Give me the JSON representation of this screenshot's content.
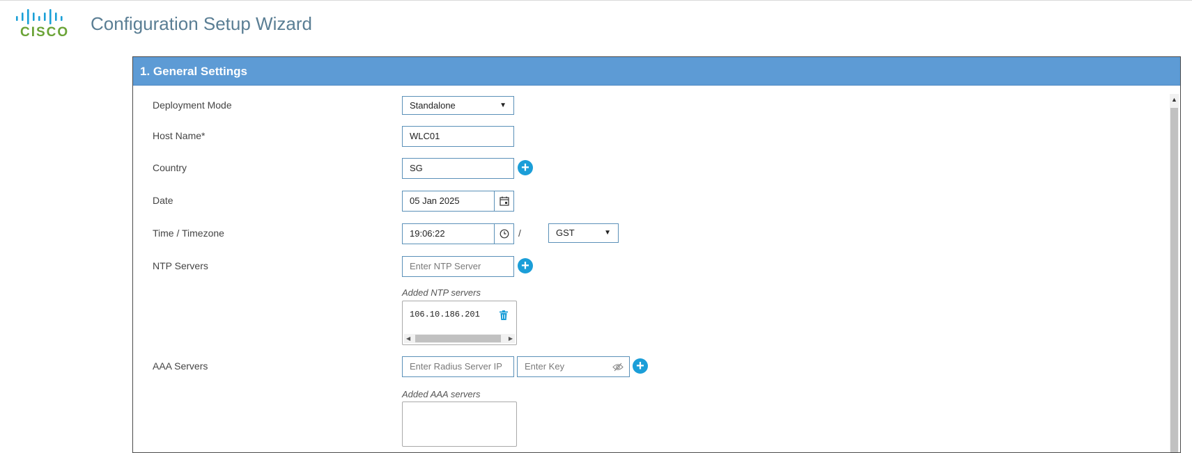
{
  "header": {
    "logo_text": "CISCO",
    "title": "Configuration Setup Wizard",
    "logo_color": "#6aa336",
    "title_color": "#5a7e94"
  },
  "panel": {
    "title": "1. General Settings",
    "header_color": "#5d9bd5"
  },
  "form": {
    "deployment_mode": {
      "label": "Deployment Mode",
      "value": "Standalone"
    },
    "host_name": {
      "label": "Host Name*",
      "value": "WLC01"
    },
    "country": {
      "label": "Country",
      "value": "SG"
    },
    "date": {
      "label": "Date",
      "value": "05 Jan 2025",
      "icon": "calendar-icon"
    },
    "time": {
      "label": "Time / Timezone",
      "value": "19:06:22",
      "separator": "/",
      "timezone": "GST",
      "icon": "clock-icon"
    },
    "ntp": {
      "label": "NTP Servers",
      "placeholder": "Enter NTP Server",
      "added_label": "Added NTP servers",
      "servers": [
        "106.10.186.201"
      ]
    },
    "aaa": {
      "label": "AAA Servers",
      "ip_placeholder": "Enter Radius Server IP",
      "key_placeholder": "Enter Key",
      "added_label": "Added AAA servers",
      "servers": []
    }
  },
  "accent_color": "#1b9ed8"
}
